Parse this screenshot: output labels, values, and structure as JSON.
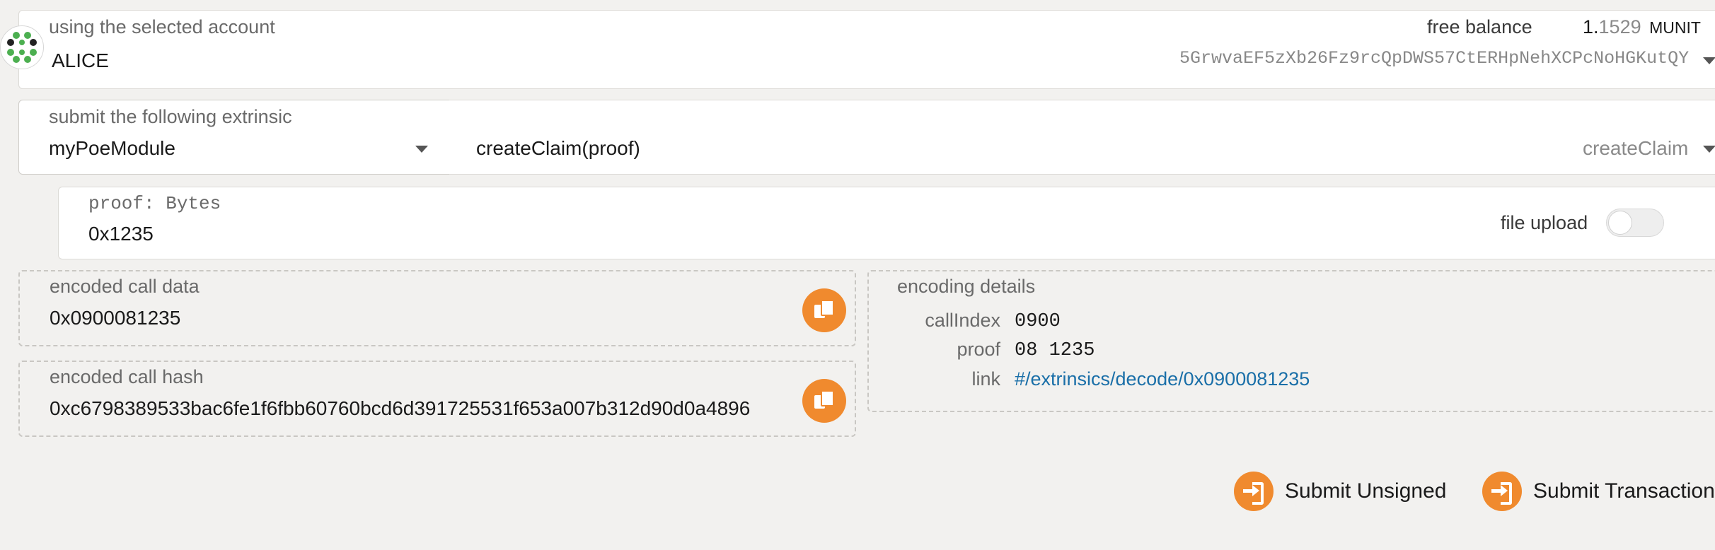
{
  "account": {
    "label": "using the selected account",
    "name": "ALICE",
    "balance_label": "free balance",
    "balance_int": "1.",
    "balance_frac": "1529",
    "balance_unit": "MUNIT",
    "address": "5GrwvaEF5zXb26Fz9rcQpDWS57CtERHpNehXCPcNoHGKutQY"
  },
  "extrinsic": {
    "label": "submit the following extrinsic",
    "module": "myPoeModule",
    "call": "createClaim(proof)",
    "call_short": "createClaim"
  },
  "param": {
    "label": "proof: Bytes",
    "value": "0x1235",
    "file_upload_label": "file upload",
    "file_upload_on": false
  },
  "encoded": {
    "data_label": "encoded call data",
    "data_value": "0x0900081235",
    "hash_label": "encoded call hash",
    "hash_value": "0xc6798389533bac6fe1f6fbb60760bcd6d391725531f653a007b312d90d0a4896"
  },
  "details": {
    "label": "encoding details",
    "rows": [
      {
        "key": "callIndex",
        "value": "0900"
      },
      {
        "key": "proof",
        "value": "08 1235"
      },
      {
        "key": "link",
        "value": "#/extrinsics/decode/0x0900081235"
      }
    ]
  },
  "actions": {
    "unsigned": "Submit Unsigned",
    "transaction": "Submit Transaction"
  },
  "colors": {
    "accent": "#f08a2e",
    "link": "#1a6fa8",
    "background": "#f2f1ef"
  },
  "icons": [
    "identicon",
    "copy-icon",
    "sign-in-icon",
    "chevron-down-icon"
  ]
}
